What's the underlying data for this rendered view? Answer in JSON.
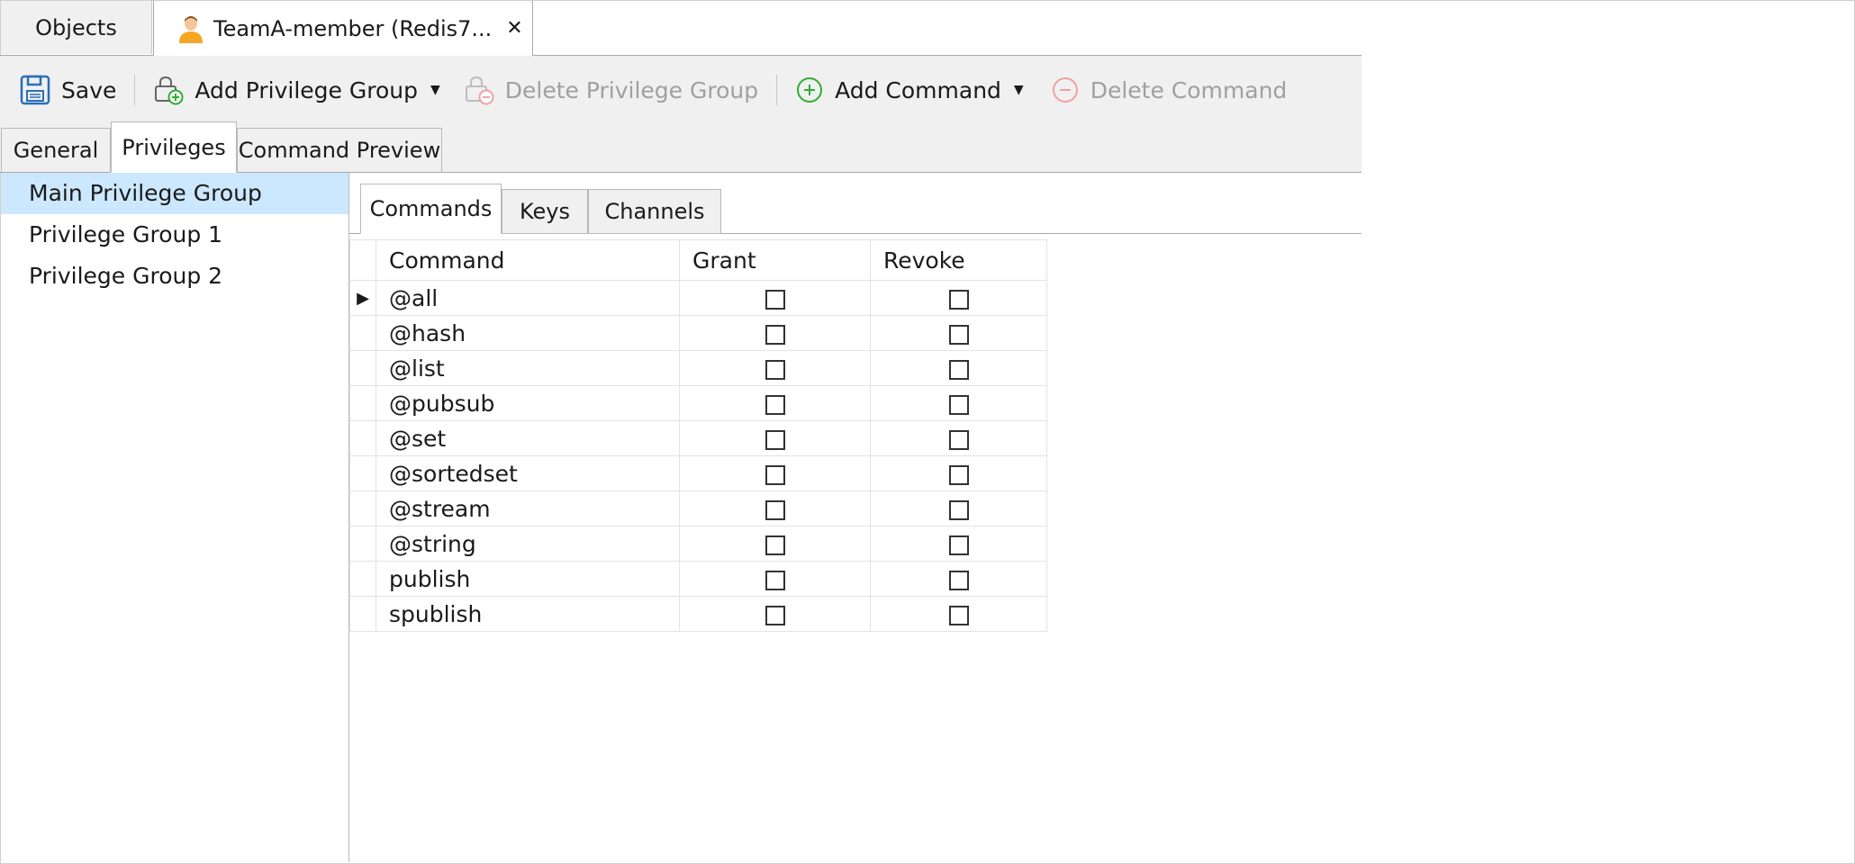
{
  "doc_tabs": {
    "objects_label": "Objects",
    "active_label": "TeamA-member (Redis7..."
  },
  "toolbar": {
    "save_label": "Save",
    "add_privilege_group_label": "Add Privilege Group",
    "delete_privilege_group_label": "Delete Privilege Group",
    "add_command_label": "Add Command",
    "delete_command_label": "Delete Command"
  },
  "section_tabs": {
    "general": "General",
    "privileges": "Privileges",
    "command_preview": "Command Preview"
  },
  "privilege_groups": [
    {
      "label": "Main Privilege Group",
      "selected": true
    },
    {
      "label": "Privilege Group 1",
      "selected": false
    },
    {
      "label": "Privilege Group 2",
      "selected": false
    }
  ],
  "inner_tabs": {
    "commands": "Commands",
    "keys": "Keys",
    "channels": "Channels"
  },
  "grid": {
    "headers": {
      "command": "Command",
      "grant": "Grant",
      "revoke": "Revoke"
    },
    "rows": [
      {
        "command": "@all",
        "grant": false,
        "revoke": false,
        "current": true
      },
      {
        "command": "@hash",
        "grant": false,
        "revoke": false
      },
      {
        "command": "@list",
        "grant": false,
        "revoke": false
      },
      {
        "command": "@pubsub",
        "grant": false,
        "revoke": false
      },
      {
        "command": "@set",
        "grant": false,
        "revoke": false
      },
      {
        "command": "@sortedset",
        "grant": false,
        "revoke": false
      },
      {
        "command": "@stream",
        "grant": false,
        "revoke": false
      },
      {
        "command": "@string",
        "grant": false,
        "revoke": false
      },
      {
        "command": "publish",
        "grant": false,
        "revoke": false
      },
      {
        "command": "spublish",
        "grant": false,
        "revoke": false
      }
    ]
  },
  "icons": {
    "user": "user-icon",
    "save": "floppy-disk-icon",
    "add_group": "lock-plus-icon",
    "delete_group": "lock-minus-icon",
    "add_command": "plus-circle-icon",
    "delete_command": "minus-circle-icon"
  },
  "colors": {
    "selection": "#cce8ff",
    "toolbar_bg": "#f0f0f0",
    "add_green": "#2fae2f",
    "delete_red": "#f08080"
  }
}
